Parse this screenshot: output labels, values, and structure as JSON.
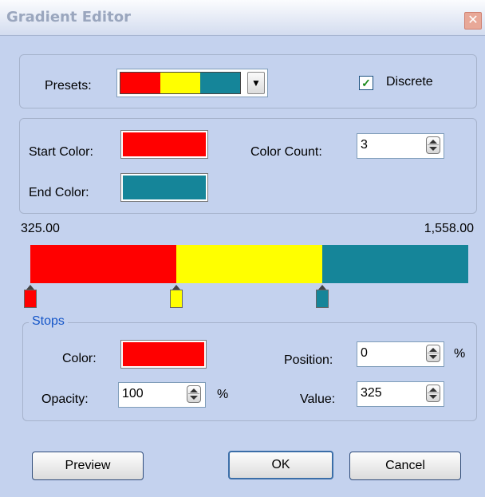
{
  "window": {
    "title": "Gradient Editor",
    "close_glyph": "✕"
  },
  "presets": {
    "label": "Presets:",
    "selected_colors": [
      "#ff0000",
      "#ffff00",
      "#158599"
    ],
    "dropdown_glyph": "▼"
  },
  "discrete": {
    "label": "Discrete",
    "checked": true,
    "check_glyph": "✓"
  },
  "colors": {
    "start_label": "Start Color:",
    "start_color": "#ff0000",
    "end_label": "End Color:",
    "end_color": "#158599",
    "count_label": "Color Count:",
    "count_value": "3"
  },
  "range": {
    "min": "325.00",
    "max": "1,558.00"
  },
  "gradient": {
    "segments": [
      {
        "color": "#ff0000",
        "fraction": 0.333
      },
      {
        "color": "#ffff00",
        "fraction": 0.333
      },
      {
        "color": "#158599",
        "fraction": 0.334
      }
    ],
    "stops": [
      {
        "color": "#ff0000",
        "position": 0
      },
      {
        "color": "#ffff00",
        "position": 0.333
      },
      {
        "color": "#158599",
        "position": 0.667
      }
    ]
  },
  "stops_group": {
    "legend": "Stops",
    "color_label": "Color:",
    "color": "#ff0000",
    "position_label": "Position:",
    "position_value": "0",
    "position_unit": "%",
    "opacity_label": "Opacity:",
    "opacity_value": "100",
    "opacity_unit": "%",
    "value_label": "Value:",
    "value_value": "325"
  },
  "buttons": {
    "preview": "Preview",
    "ok": "OK",
    "cancel": "Cancel"
  }
}
